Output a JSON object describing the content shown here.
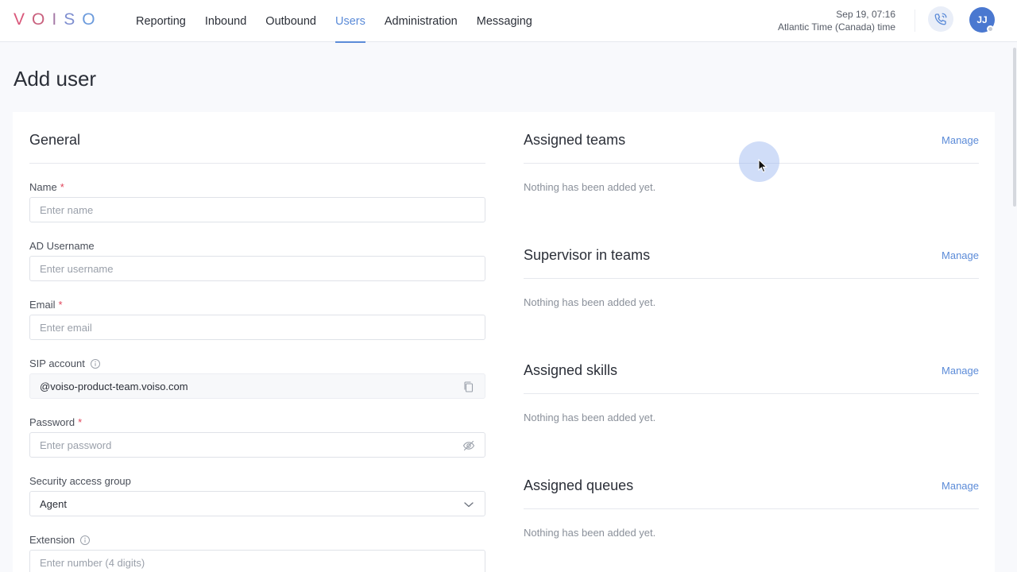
{
  "brand": {
    "logo_letters": [
      "V",
      "O",
      "I",
      "S",
      "O"
    ],
    "logo_colors": [
      "#d9577a",
      "#c9617e",
      "#a57aa6",
      "#7f8fd0",
      "#6c9bdc"
    ]
  },
  "nav": {
    "items": [
      {
        "label": "Reporting"
      },
      {
        "label": "Inbound"
      },
      {
        "label": "Outbound"
      },
      {
        "label": "Users",
        "active": true
      },
      {
        "label": "Administration"
      },
      {
        "label": "Messaging"
      }
    ]
  },
  "header": {
    "date": "Sep 19, 07:16",
    "timezone": "Atlantic Time (Canada) time",
    "avatar_initials": "JJ"
  },
  "page": {
    "title": "Add user"
  },
  "general": {
    "title": "General",
    "fields": {
      "name": {
        "label": "Name",
        "required": "*",
        "placeholder": "Enter name"
      },
      "ad_username": {
        "label": "AD Username",
        "placeholder": "Enter username"
      },
      "email": {
        "label": "Email",
        "required": "*",
        "placeholder": "Enter email"
      },
      "sip_account": {
        "label": "SIP account",
        "value": "@voiso-product-team.voiso.com"
      },
      "password": {
        "label": "Password",
        "required": "*",
        "placeholder": "Enter password"
      },
      "security_group": {
        "label": "Security access group",
        "value": "Agent"
      },
      "extension": {
        "label": "Extension",
        "placeholder": "Enter number (4 digits)"
      }
    }
  },
  "right": {
    "manage_label": "Manage",
    "empty_text": "Nothing has been added yet.",
    "sections": [
      {
        "title": "Assigned teams"
      },
      {
        "title": "Supervisor in teams"
      },
      {
        "title": "Assigned skills"
      },
      {
        "title": "Assigned queues"
      }
    ]
  },
  "colors": {
    "accent": "#5b8bd8",
    "required": "#e0445a",
    "avatar": "#4a78d0"
  },
  "icons": [
    "phone-icon",
    "info-icon",
    "copy-icon",
    "eye-off-icon",
    "chevron-down-icon",
    "cursor-icon"
  ]
}
